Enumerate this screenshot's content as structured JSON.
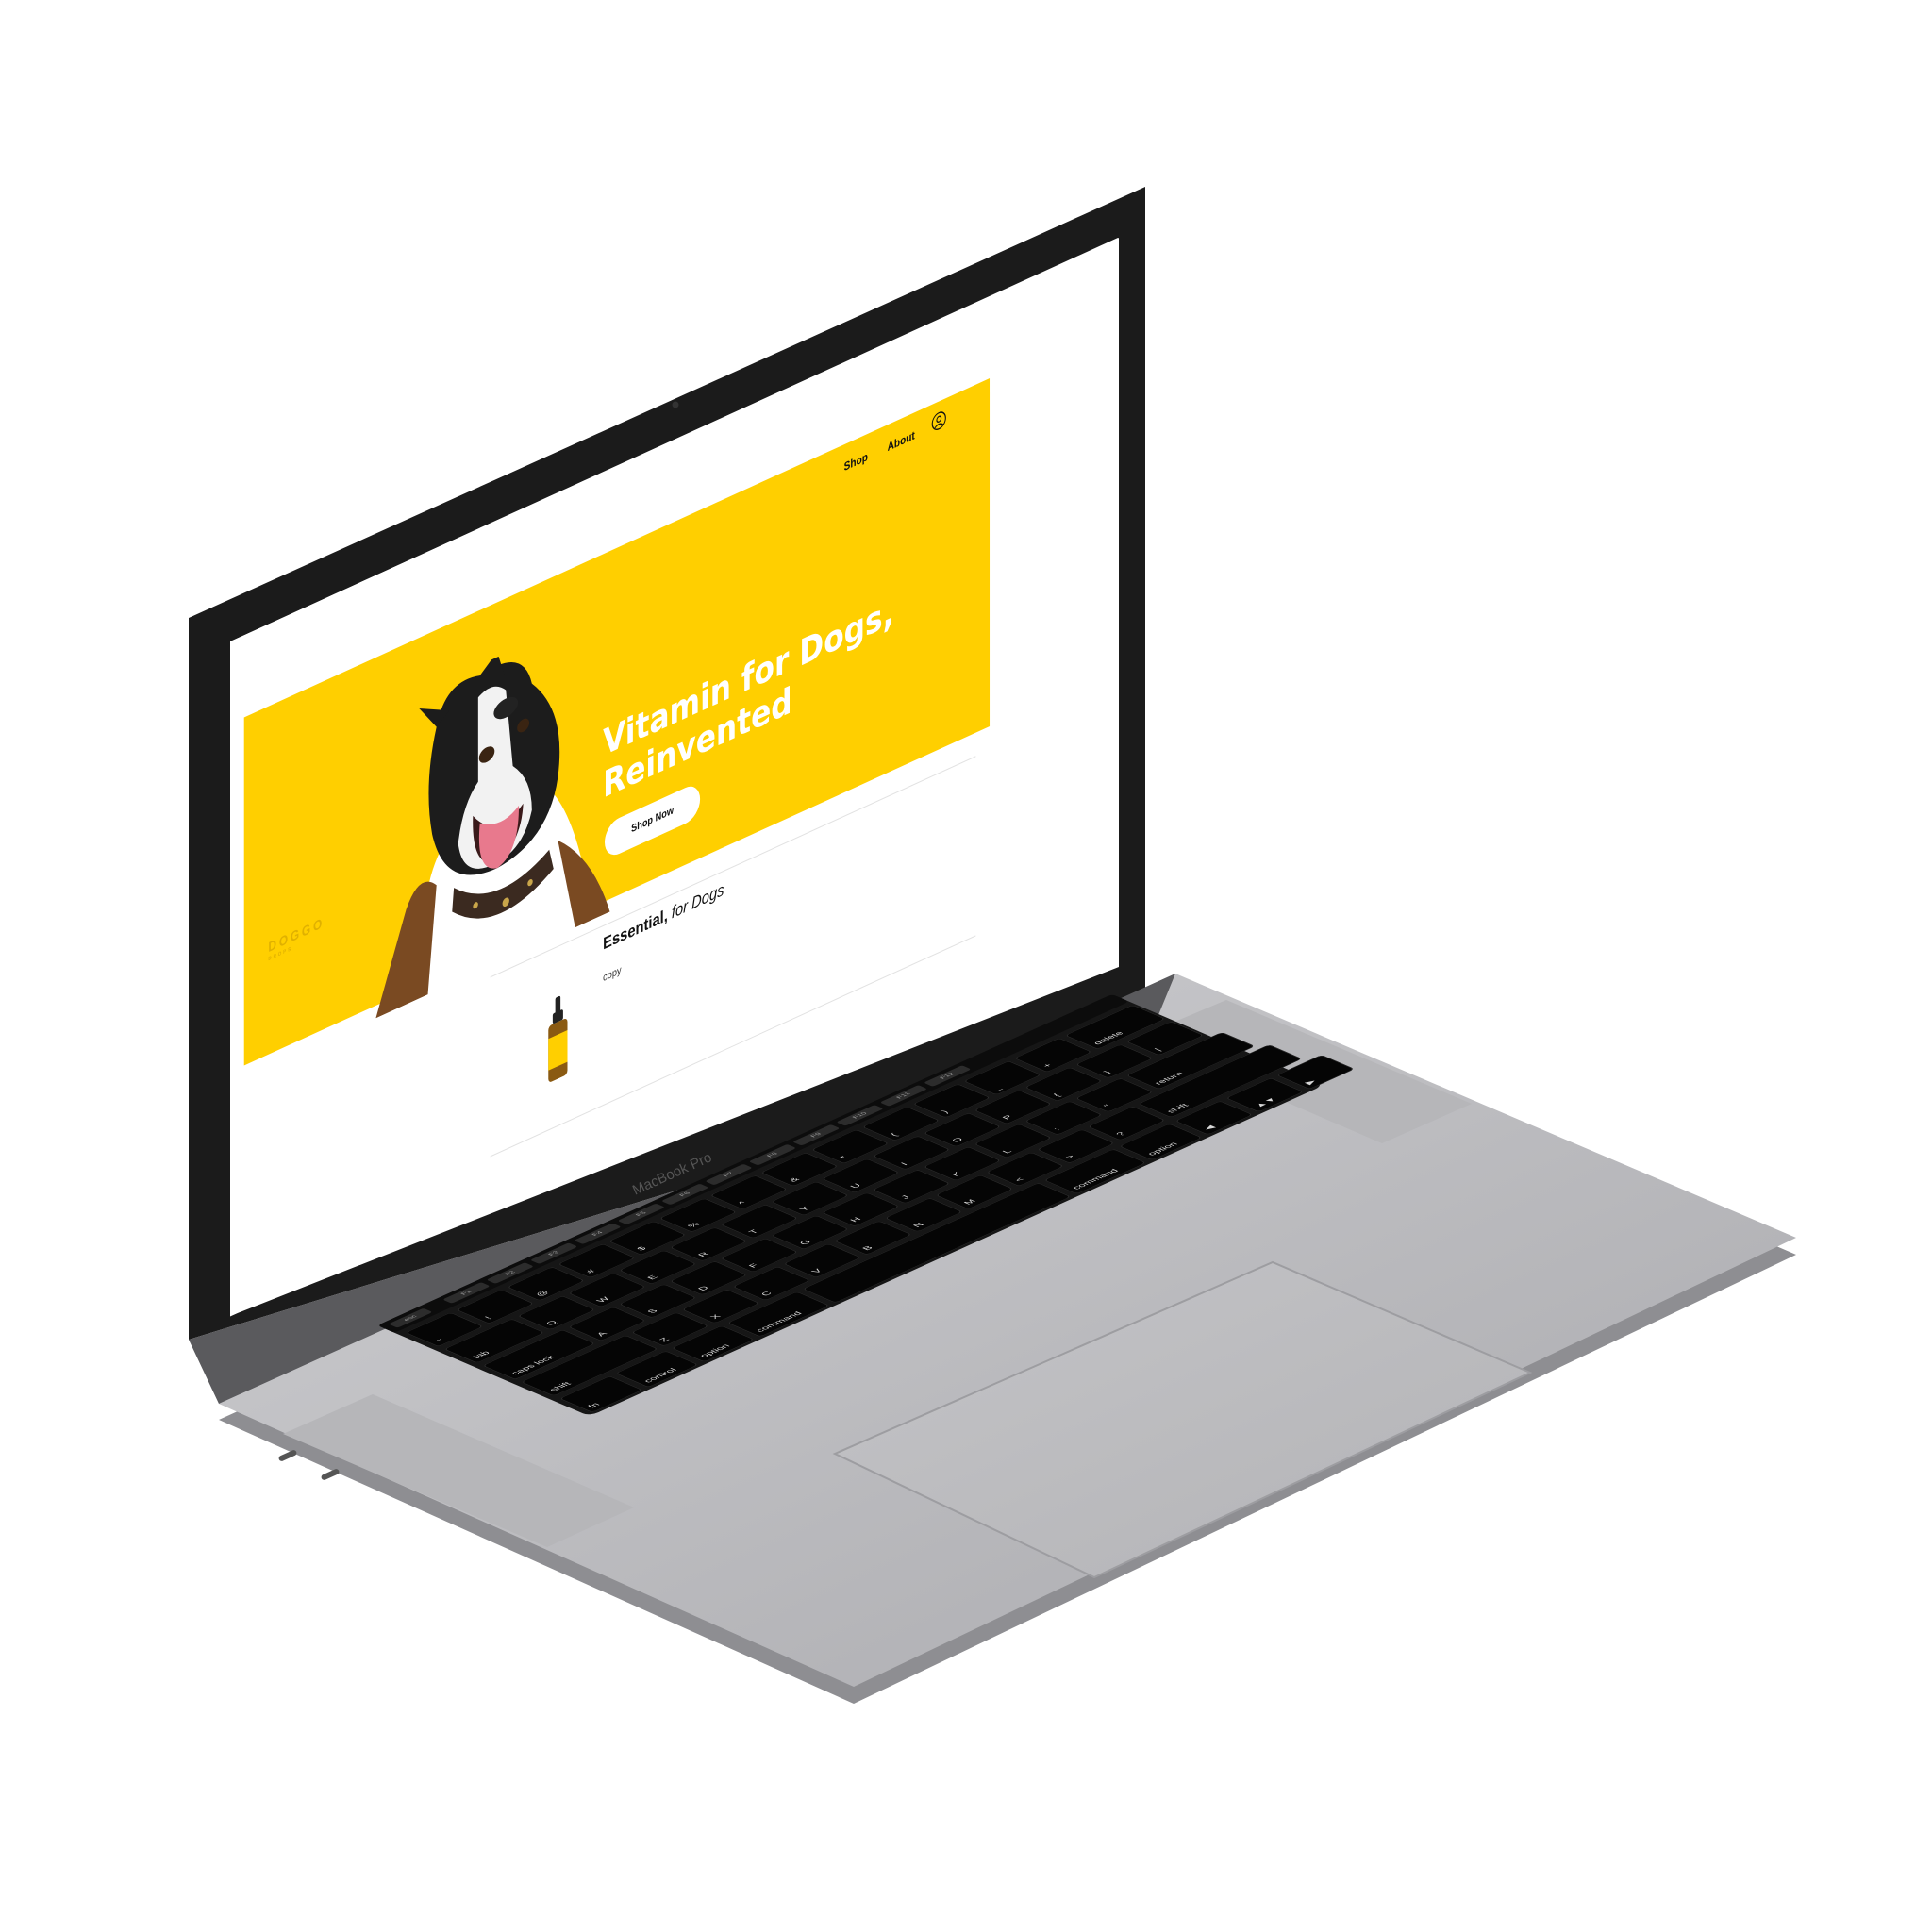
{
  "site": {
    "logo": {
      "name": "DOGGO",
      "tagline": "DROPS"
    },
    "nav": {
      "shop": "Shop",
      "about": "About",
      "account_icon": "user-icon"
    },
    "hero": {
      "headline_line1": "Vitamin for Dogs,",
      "headline_line2": "Reinvented",
      "cta": "Shop Now",
      "accent_color": "#ffcf00"
    },
    "product": {
      "title_bold": "Essential,",
      "title_italic": "for Dogs",
      "copy": "copy"
    }
  },
  "device": {
    "label": "MacBook Pro",
    "touchbar": [
      "esc",
      "F1",
      "F2",
      "F3",
      "F4",
      "F5",
      "F6",
      "F7",
      "F8",
      "F9",
      "F10",
      "F11",
      "F12"
    ],
    "keyboard_rows": [
      [
        "~",
        "!",
        "@",
        "#",
        "$",
        "%",
        "^",
        "&",
        "*",
        "(",
        ")",
        "_",
        "+",
        "delete"
      ],
      [
        "tab",
        "Q",
        "W",
        "E",
        "R",
        "T",
        "Y",
        "U",
        "I",
        "O",
        "P",
        "{",
        "}",
        "|"
      ],
      [
        "caps lock",
        "A",
        "S",
        "D",
        "F",
        "G",
        "H",
        "J",
        "K",
        "L",
        ":",
        "\"",
        "return"
      ],
      [
        "shift",
        "Z",
        "X",
        "C",
        "V",
        "B",
        "N",
        "M",
        "<",
        ">",
        "?",
        "shift"
      ],
      [
        "fn",
        "control",
        "option",
        "command",
        "",
        "command",
        "option",
        "◀",
        "▲▼",
        "▶"
      ]
    ]
  }
}
